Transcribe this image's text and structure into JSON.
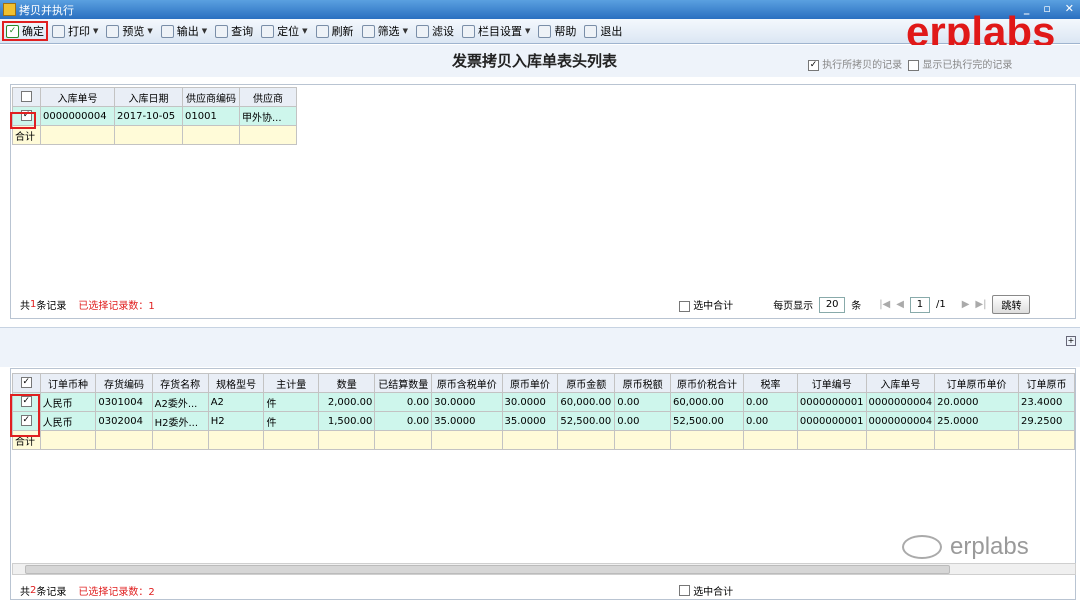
{
  "window": {
    "title": "拷贝并执行",
    "controls": [
      "_",
      "▫",
      "✕"
    ]
  },
  "toolbar": {
    "items": [
      {
        "label": "确定",
        "icon": "check-icon",
        "dropdown": false
      },
      {
        "label": "打印",
        "icon": "printer-icon",
        "dropdown": true
      },
      {
        "label": "预览",
        "icon": "preview-icon",
        "dropdown": true
      },
      {
        "label": "输出",
        "icon": "export-icon",
        "dropdown": true
      },
      {
        "label": "查询",
        "icon": "search-icon",
        "dropdown": false
      },
      {
        "label": "定位",
        "icon": "locate-icon",
        "dropdown": true
      },
      {
        "label": "刷新",
        "icon": "refresh-icon",
        "dropdown": false
      },
      {
        "label": "筛选",
        "icon": "filter-icon",
        "dropdown": true
      },
      {
        "label": "滤设",
        "icon": "filter-settings-icon",
        "dropdown": false
      },
      {
        "label": "栏目设置",
        "icon": "column-settings-icon",
        "dropdown": true
      },
      {
        "label": "帮助",
        "icon": "help-icon",
        "dropdown": false
      },
      {
        "label": "退出",
        "icon": "exit-icon",
        "dropdown": false
      }
    ]
  },
  "brand": "erplabs",
  "page": {
    "title": "发票拷贝入库单表头列表",
    "opt_copy": "执行所拷贝的记录",
    "opt_show_done": "显示已执行完的记录"
  },
  "top_grid": {
    "headers": [
      "入库单号",
      "入库日期",
      "供应商编码",
      "供应商"
    ],
    "rows": [
      [
        "0000000004",
        "2017-10-05",
        "01001",
        "甲外协..."
      ]
    ],
    "sum_label": "合计",
    "status": {
      "prefix": "共",
      "count": "1",
      "suffix": "条记录",
      "selected": "已选择记录数：1"
    }
  },
  "top_pager": {
    "select_total": "选中合计",
    "per_page_label": "每页显示",
    "per_page": "20",
    "per_page_unit": "条",
    "page": "1",
    "total": "/1",
    "jump": "跳转"
  },
  "bottom_grid": {
    "headers": [
      "订单币种",
      "存货编码",
      "存货名称",
      "规格型号",
      "主计量",
      "数量",
      "已结算数量",
      "原币含税单价",
      "原币单价",
      "原币金额",
      "原币税额",
      "原币价税合计",
      "税率",
      "订单编号",
      "入库单号",
      "订单原币单价",
      "订单原币"
    ],
    "rows": [
      [
        "人民币",
        "0301004",
        "A2委外...",
        "A2",
        "件",
        "2,000.00",
        "0.00",
        "30.0000",
        "30.0000",
        "60,000.00",
        "0.00",
        "60,000.00",
        "0.00",
        "0000000001",
        "0000000004",
        "20.0000",
        "23.4000"
      ],
      [
        "人民币",
        "0302004",
        "H2委外...",
        "H2",
        "件",
        "1,500.00",
        "0.00",
        "35.0000",
        "35.0000",
        "52,500.00",
        "0.00",
        "52,500.00",
        "0.00",
        "0000000001",
        "0000000004",
        "25.0000",
        "29.2500"
      ]
    ],
    "sum_label": "合计",
    "status": {
      "prefix": "共",
      "count": "2",
      "suffix": "条记录",
      "selected": "已选择记录数：2"
    },
    "select_total": "选中合计"
  },
  "watermark": "erplabs"
}
